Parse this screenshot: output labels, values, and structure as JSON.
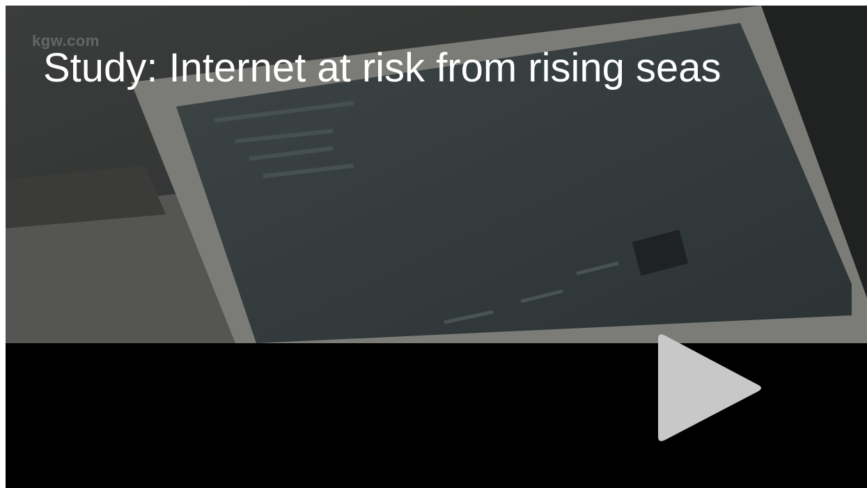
{
  "video": {
    "title": "Study: Internet at risk from rising seas",
    "watermark": "kgw.com",
    "play_icon": "play-icon",
    "play_color": "#c8c8c8"
  }
}
